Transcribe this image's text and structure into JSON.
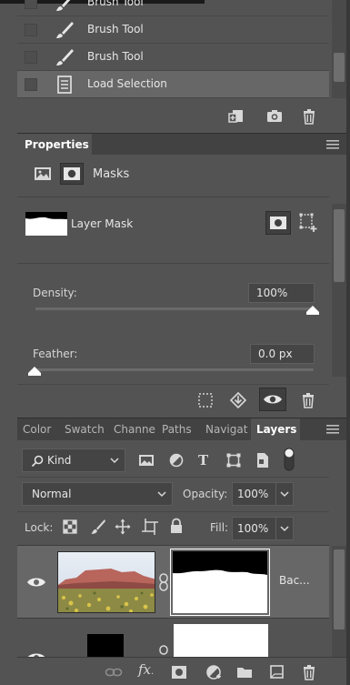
{
  "history": {
    "items": [
      {
        "label": "Brush Tool",
        "icon": "brush-icon",
        "selected": false
      },
      {
        "label": "Brush Tool",
        "icon": "brush-icon",
        "selected": false
      },
      {
        "label": "Brush Tool",
        "icon": "brush-icon",
        "selected": false
      },
      {
        "label": "Load Selection",
        "icon": "document-icon",
        "selected": true
      }
    ],
    "footer_icons": [
      "new-document-from-state-icon",
      "camera-icon",
      "trash-icon"
    ]
  },
  "properties": {
    "tab_label": "Properties",
    "section_label": "Masks",
    "layer_mask_label": "Layer Mask",
    "density_label": "Density:",
    "density_value": "100%",
    "density_level": 1.0,
    "feather_label": "Feather:",
    "feather_value": "0.0 px",
    "feather_level": 0.0,
    "footer_icons": [
      "load-selection-icon",
      "apply-mask-icon",
      "visibility-eye-icon",
      "trash-icon"
    ]
  },
  "layers_panel": {
    "tabs": [
      {
        "label": "Color",
        "active": false
      },
      {
        "label": "Swatch",
        "active": false
      },
      {
        "label": "Channe",
        "active": false
      },
      {
        "label": "Paths",
        "active": false
      },
      {
        "label": "Navigat",
        "active": false
      },
      {
        "label": "Layers",
        "active": true
      }
    ],
    "filter_kind": "Kind",
    "blend_mode": "Normal",
    "opacity_label": "Opacity:",
    "opacity_value": "100%",
    "lock_label": "Lock:",
    "fill_label": "Fill:",
    "fill_value": "100%",
    "layers": [
      {
        "name": "Bac...",
        "visible": true,
        "selected": true
      },
      {
        "name": "",
        "visible": true,
        "selected": false
      }
    ],
    "footer_icons": [
      "link-icon",
      "fx-icon",
      "add-mask-icon",
      "adjustment-icon",
      "folder-icon",
      "new-layer-icon",
      "trash-icon"
    ]
  },
  "colors": {
    "panel_bg": "#535353",
    "selected_row": "#676767",
    "tab_bar": "#424242"
  }
}
